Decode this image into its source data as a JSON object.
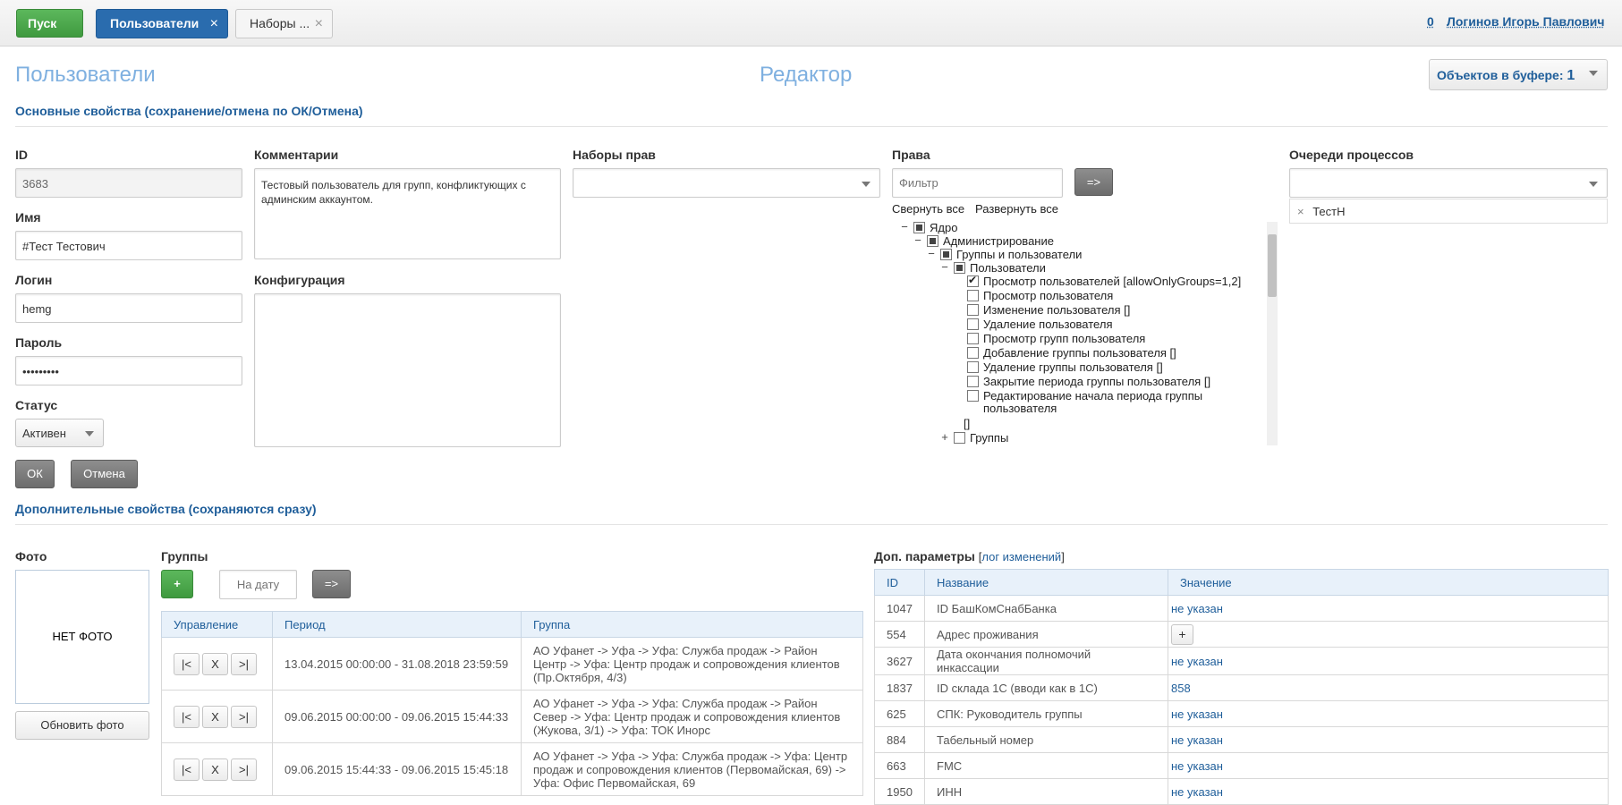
{
  "topbar": {
    "start_label": "Пуск",
    "tabs": [
      {
        "label": "Пользователи"
      },
      {
        "label": "Наборы ..."
      }
    ],
    "close_glyph": "×",
    "notifications_count": "0",
    "user_name": "Логинов Игорь Павлович"
  },
  "header": {
    "title": "Пользователи",
    "editor_title": "Редактор",
    "buffer_label": "Объектов в буфере:",
    "buffer_count": "1"
  },
  "main_section": {
    "title": "Основные свойства (сохранение/отмена по ОК/Отмена)",
    "id_label": "ID",
    "id_value": "3683",
    "name_label": "Имя",
    "name_value": "#Тест Тестович",
    "login_label": "Логин",
    "login_value": "hemg",
    "password_label": "Пароль",
    "password_value": "•••••••••",
    "status_label": "Статус",
    "status_value": "Активен",
    "comments_label": "Комментарии",
    "comments_value": "Тестовый пользователь для групп, конфликтующих с админским аккаунтом.",
    "config_label": "Конфигурация",
    "config_value": "",
    "rightsets_label": "Наборы прав",
    "rightsets_value": "",
    "rights_label": "Права",
    "rights_filter_placeholder": "Фильтр",
    "rights_apply_label": "=>",
    "collapse_all": "Свернуть все",
    "expand_all": "Развернуть все",
    "queues_label": "Очереди процессов",
    "queues_value": "",
    "queue_tag": "ТестН",
    "ok_label": "ОК",
    "cancel_label": "Отмена"
  },
  "rights_tree": [
    {
      "toggle": "−",
      "state": "partial",
      "label": "Ядро"
    },
    {
      "toggle": "−",
      "state": "partial",
      "label": "Администрирование"
    },
    {
      "toggle": "−",
      "state": "partial",
      "label": "Группы и пользователи"
    },
    {
      "toggle": "−",
      "state": "partial",
      "label": "Пользователи"
    },
    {
      "toggle": "",
      "state": "checked",
      "label": "Просмотр пользователей [allowOnlyGroups=1,2]"
    },
    {
      "toggle": "",
      "state": "empty",
      "label": "Просмотр пользователя"
    },
    {
      "toggle": "",
      "state": "empty",
      "label": "Изменение пользователя []"
    },
    {
      "toggle": "",
      "state": "empty",
      "label": "Удаление пользователя"
    },
    {
      "toggle": "",
      "state": "empty",
      "label": "Просмотр групп пользователя"
    },
    {
      "toggle": "",
      "state": "empty",
      "label": "Добавление группы пользователя []"
    },
    {
      "toggle": "",
      "state": "empty",
      "label": "Удаление группы пользователя []"
    },
    {
      "toggle": "",
      "state": "empty",
      "label": "Закрытие периода группы пользователя []"
    },
    {
      "toggle": "",
      "state": "empty",
      "label": "Редактирование начала периода группы",
      "label2": "пользователя"
    },
    {
      "toggle": "",
      "state": "none",
      "label": "[]"
    },
    {
      "toggle": "+",
      "state": "empty",
      "label": "Группы"
    }
  ],
  "extra_section": {
    "title": "Дополнительные свойства (сохраняются сразу)",
    "photo_label": "Фото",
    "no_photo": "НЕТ ФОТО",
    "update_photo": "Обновить фото",
    "groups_label": "Группы",
    "add_label": "+",
    "date_placeholder": "На дату",
    "apply_label": "=>",
    "params_label": "Доп. параметры",
    "log_link": "лог изменений"
  },
  "groups_table": {
    "columns": [
      "Управление",
      "Период",
      "Группа"
    ],
    "controls": [
      "|<",
      "X",
      ">|"
    ],
    "rows": [
      {
        "period": "13.04.2015 00:00:00 - 31.08.2018 23:59:59",
        "group": [
          "АО Уфанет -> Уфа -> Уфа: Служба продаж -> Район",
          "Центр -> Уфа: Центр продаж и сопровождения клиентов",
          "(Пр.Октября, 4/3)"
        ]
      },
      {
        "period": "09.06.2015 00:00:00 - 09.06.2015 15:44:33",
        "group": [
          "АО Уфанет -> Уфа -> Уфа: Служба продаж -> Район",
          "Север -> Уфа: Центр продаж и сопровождения клиентов",
          "(Жукова, 3/1) -> Уфа: ТОК Инорс"
        ]
      },
      {
        "period": "09.06.2015 15:44:33 - 09.06.2015 15:45:18",
        "group": [
          "АО Уфанет -> Уфа -> Уфа: Служба продаж -> Уфа: Центр",
          "продаж и сопровождения клиентов (Первомайская, 69) ->",
          "Уфа: Офис Первомайская, 69"
        ]
      }
    ]
  },
  "params_table": {
    "columns": [
      "ID",
      "Название",
      "Значение"
    ],
    "rows": [
      {
        "id": "1047",
        "name": "ID БашКомСнабБанка",
        "value": "не указан",
        "kind": "link"
      },
      {
        "id": "554",
        "name": "Адрес проживания",
        "value": "+",
        "kind": "button"
      },
      {
        "id": "3627",
        "name": "Дата окончания полномочий инкассации",
        "value": "не указан",
        "kind": "link"
      },
      {
        "id": "1837",
        "name": "ID склада 1С (вводи как в 1С)",
        "value": "858",
        "kind": "link"
      },
      {
        "id": "625",
        "name": "СПК: Руководитель группы",
        "value": "не указан",
        "kind": "link"
      },
      {
        "id": "884",
        "name": "Табельный номер",
        "value": "не указан",
        "kind": "link"
      },
      {
        "id": "663",
        "name": "FMC",
        "value": "не указан",
        "kind": "link"
      },
      {
        "id": "1950",
        "name": "ИНН",
        "value": "не указан",
        "kind": "link"
      }
    ]
  },
  "colors": {
    "accent": "#1f5e9a",
    "title_light": "#7fb0e0",
    "green": "#4cae4c",
    "active_tab": "#2a6cae"
  }
}
